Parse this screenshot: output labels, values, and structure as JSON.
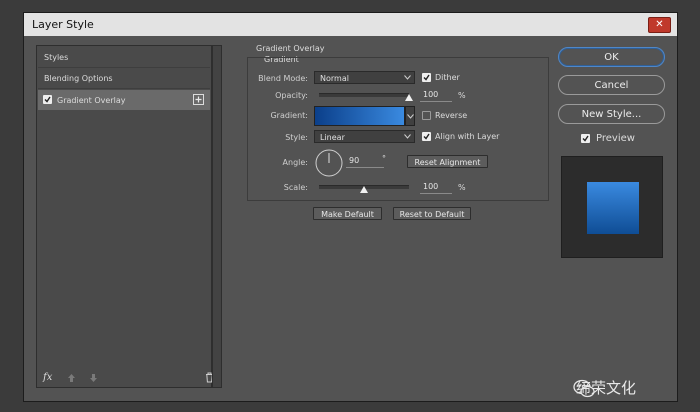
{
  "window": {
    "title": "Layer Style",
    "close_glyph": "✕"
  },
  "left_panel": {
    "items": [
      {
        "label": "Styles"
      },
      {
        "label": "Blending Options"
      },
      {
        "label": "Gradient Overlay",
        "checked": true,
        "selected": true
      }
    ],
    "footer_icons": [
      "fx-icon",
      "arrow-up-icon",
      "arrow-down-icon",
      "trash-icon"
    ]
  },
  "gradient_overlay": {
    "group_title": "Gradient Overlay",
    "sub_title": "Gradient",
    "blend_mode": {
      "label": "Blend Mode:",
      "value": "Normal"
    },
    "dither": {
      "label": "Dither",
      "checked": true
    },
    "opacity": {
      "label": "Opacity:",
      "value": "100",
      "unit": "%",
      "level": 1.0
    },
    "gradient": {
      "label": "Gradient:",
      "start_color": "#0b3f8a",
      "end_color": "#3a8ae0"
    },
    "reverse": {
      "label": "Reverse",
      "checked": false
    },
    "style": {
      "label": "Style:",
      "value": "Linear"
    },
    "align_with_layer": {
      "label": "Align with Layer",
      "checked": true
    },
    "angle": {
      "label": "Angle:",
      "value": "90",
      "unit": "°"
    },
    "reset_alignment": "Reset Alignment",
    "scale": {
      "label": "Scale:",
      "value": "100",
      "unit": "%",
      "level": 0.5
    },
    "make_default": "Make Default",
    "reset_to_default": "Reset to Default"
  },
  "right_panel": {
    "ok": "OK",
    "cancel": "Cancel",
    "new_style": "New Style...",
    "preview_label": "Preview",
    "preview_checked": true
  },
  "watermark": "缔荣文化",
  "colors": {
    "accent": "#4f87c8",
    "swatch_top": "#3a8ae0",
    "swatch_bottom": "#0f4d95"
  }
}
